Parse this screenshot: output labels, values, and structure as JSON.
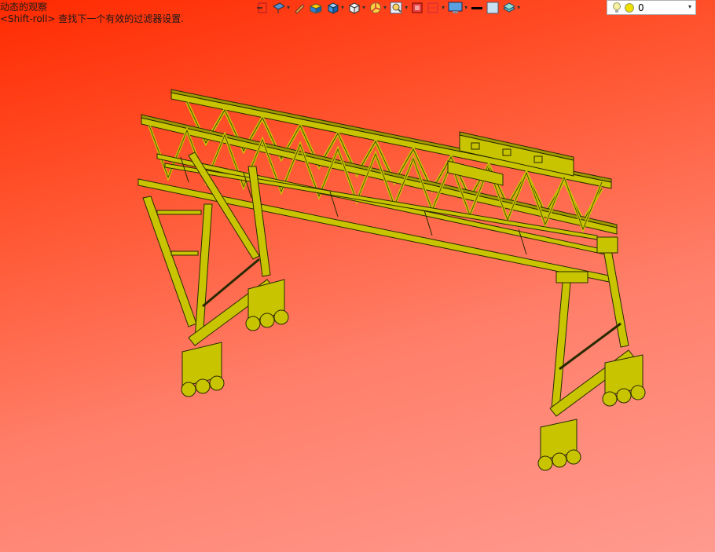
{
  "command_prompt": {
    "line1": "动态的观察",
    "line2": "<Shift-roll> 查找下一个有效的过滤器设置."
  },
  "toolbar": {
    "icons": [
      "select-frame-icon",
      "view-orient-icon",
      "pencil-icon",
      "box-yellow-icon",
      "cube-blue-icon",
      "cube-white-icon",
      "color-wheel-icon",
      "zoom-icon",
      "red-square-icon",
      "section-frame-icon",
      "monitor-icon",
      "line-weight-icon",
      "color-swatch-icon",
      "layers-icon"
    ],
    "colors": {
      "swatch": "#c8e0f0",
      "line_weight": "#000000"
    }
  },
  "layer_select": {
    "value": "0",
    "bulb_color": "#f7f0a0",
    "sun_color": "#f0e000"
  },
  "model": {
    "steel_color": "#c8c400",
    "outline_color": "#2a2a00"
  }
}
